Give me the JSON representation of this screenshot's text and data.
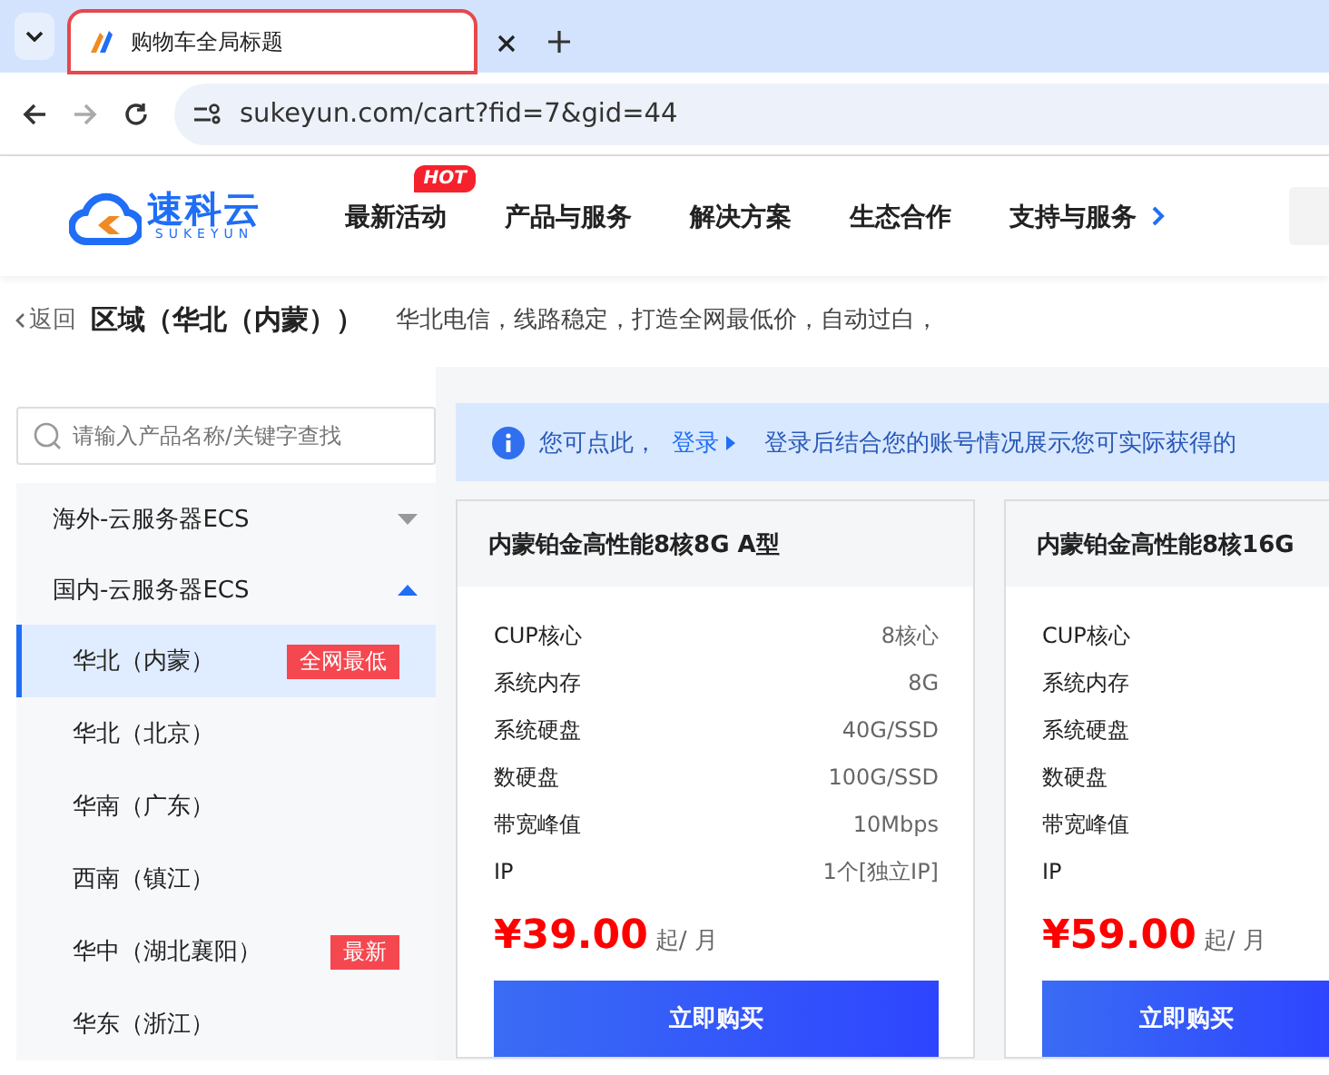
{
  "browser": {
    "tab_title": "购物车全局标题",
    "url": "sukeyun.com/cart?fid=7&gid=44"
  },
  "site_header": {
    "logo_text": "速科云",
    "logo_subtext": "SUKEYUN",
    "nav": [
      {
        "label": "最新活动",
        "badge": "HOT"
      },
      {
        "label": "产品与服务"
      },
      {
        "label": "解决方案"
      },
      {
        "label": "生态合作"
      },
      {
        "label": "支持与服务"
      }
    ]
  },
  "breadcrumb": {
    "back": "返回",
    "title": "区域（华北（内蒙））",
    "description": "华北电信，线路稳定，打造全网最低价，自动过白，"
  },
  "sidebar": {
    "search_placeholder": "请输入产品名称/关键字查找",
    "groups": [
      {
        "label": "海外-云服务器ECS",
        "expanded": false
      },
      {
        "label": "国内-云服务器ECS",
        "expanded": true,
        "children": [
          {
            "label": "华北（内蒙）",
            "selected": true,
            "tag": "全网最低"
          },
          {
            "label": "华北（北京）",
            "selected": false
          },
          {
            "label": "华南（广东）",
            "selected": false
          },
          {
            "label": "西南（镇江）",
            "selected": false
          },
          {
            "label": "华中（湖北襄阳）",
            "selected": false,
            "tag": "最新"
          },
          {
            "label": "华东（浙江）",
            "selected": false
          }
        ]
      }
    ]
  },
  "notice": {
    "prefix": "您可点此，",
    "link": "登录",
    "text": "登录后结合您的账号情况展示您可实际获得的"
  },
  "products": [
    {
      "name": "内蒙铂金高性能8核8G A型",
      "specs": [
        {
          "label": "CUP核心",
          "value": "8核心"
        },
        {
          "label": "系统内存",
          "value": "8G"
        },
        {
          "label": "系统硬盘",
          "value": "40G/SSD"
        },
        {
          "label": "数硬盘",
          "value": "100G/SSD"
        },
        {
          "label": "带宽峰值",
          "value": "10Mbps"
        },
        {
          "label": "IP",
          "value": "1个[独立IP]"
        }
      ],
      "price": "¥39.00",
      "unit": "起/ 月",
      "button": "立即购买"
    },
    {
      "name": "内蒙铂金高性能8核16G",
      "specs": [
        {
          "label": "CUP核心"
        },
        {
          "label": "系统内存"
        },
        {
          "label": "系统硬盘"
        },
        {
          "label": "数硬盘"
        },
        {
          "label": "带宽峰值"
        },
        {
          "label": "IP"
        }
      ],
      "price": "¥59.00",
      "unit": "起/ 月",
      "button": "立即购买"
    }
  ]
}
